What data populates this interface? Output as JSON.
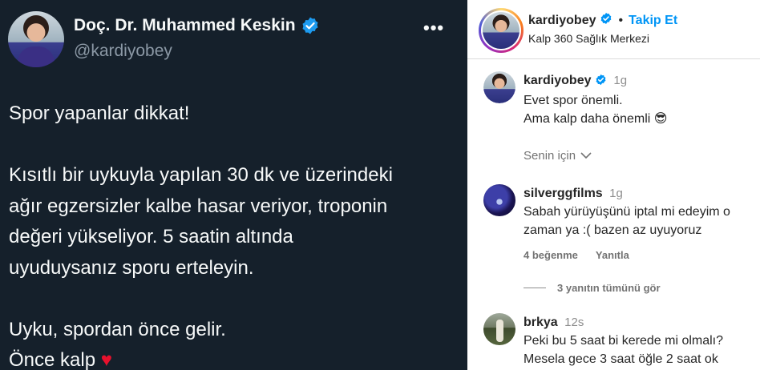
{
  "tweet": {
    "name": "Doç. Dr. Muhammed Keskin",
    "handle": "@kardiyobey",
    "more": "•••",
    "paragraphs": [
      [
        "Spor yapanlar dikkat!"
      ],
      [
        "Kısıtlı bir uykuyla yapılan 30 dk ve üzerindeki",
        "ağır egzersizler kalbe hasar veriyor, troponin",
        "değeri yükseliyor. 5 saatin altında",
        "uyuduysanız sporu erteleyin."
      ],
      [
        "Uyku, spordan önce gelir.",
        "Önce kalp"
      ]
    ],
    "heart": "♥"
  },
  "instagram": {
    "header": {
      "username": "kardiyobey",
      "separator": "•",
      "follow_label": "Takip Et",
      "subtitle": "Kalp 360 Sağlık Merkezi"
    },
    "caption": {
      "username": "kardiyobey",
      "time": "1g",
      "lines": [
        "Evet spor önemli.",
        "Ama kalp daha önemli 😎"
      ]
    },
    "for_you_label": "Senin için",
    "comments": [
      {
        "username": "silverggfilms",
        "time": "1g",
        "lines": [
          "Sabah yürüyüşünü iptal mi edeyim o",
          "zaman ya :( bazen az uyuyoruz"
        ],
        "likes": "4 beğenme",
        "reply": "Yanıtla"
      },
      {
        "username": "brkya",
        "time": "12s",
        "lines": [
          "Peki bu 5 saat bi kerede mi olmalı?",
          "Mesela gece 3 saat öğle 2 saat ok"
        ]
      }
    ],
    "view_replies": "3 yanıtın tümünü gör"
  },
  "colors": {
    "tweet_bg": "#15202b",
    "verified_blue": "#1d9bf0",
    "ig_verified": "#0095f6",
    "follow_blue": "#0095f6",
    "heart_red": "#e8112d"
  },
  "icons": [
    "verified-badge-icon",
    "more-options-icon",
    "heart-emoji-icon",
    "chevron-down-icon",
    "sunglasses-emoji-icon"
  ]
}
